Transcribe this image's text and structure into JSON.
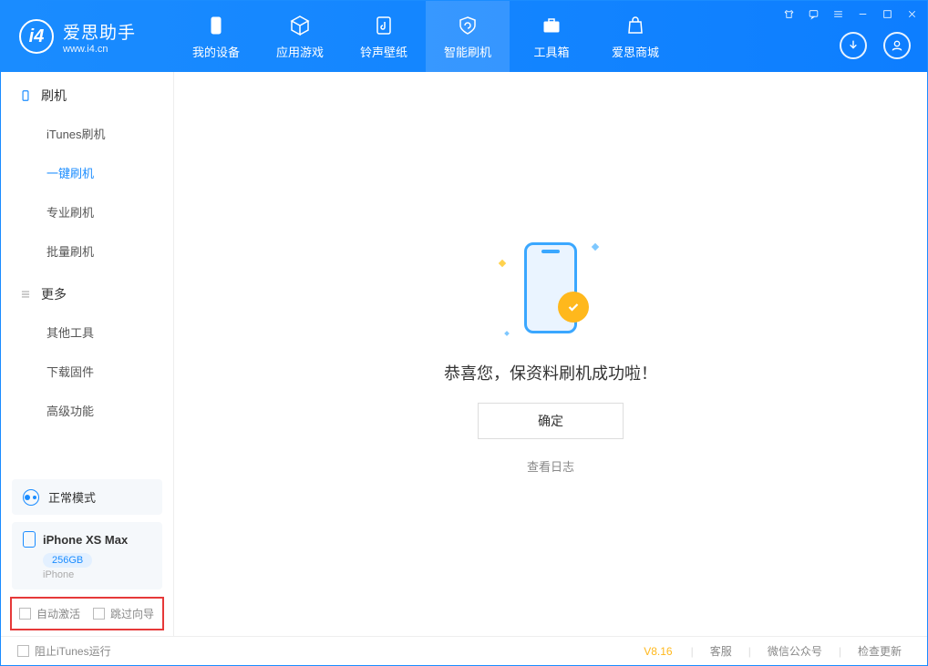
{
  "app": {
    "title": "爱思助手",
    "subtitle": "www.i4.cn"
  },
  "nav": {
    "tabs": [
      {
        "label": "我的设备"
      },
      {
        "label": "应用游戏"
      },
      {
        "label": "铃声壁纸"
      },
      {
        "label": "智能刷机"
      },
      {
        "label": "工具箱"
      },
      {
        "label": "爱思商城"
      }
    ],
    "active_index": 3
  },
  "sidebar": {
    "sections": [
      {
        "title": "刷机",
        "items": [
          {
            "label": "iTunes刷机"
          },
          {
            "label": "一键刷机"
          },
          {
            "label": "专业刷机"
          },
          {
            "label": "批量刷机"
          }
        ],
        "active_index": 1
      },
      {
        "title": "更多",
        "items": [
          {
            "label": "其他工具"
          },
          {
            "label": "下载固件"
          },
          {
            "label": "高级功能"
          }
        ]
      }
    ],
    "mode": {
      "label": "正常模式"
    },
    "device": {
      "name": "iPhone XS Max",
      "storage": "256GB",
      "type": "iPhone"
    },
    "checkboxes": {
      "auto_activate": "自动激活",
      "skip_guide": "跳过向导"
    }
  },
  "main": {
    "success_message": "恭喜您，保资料刷机成功啦！",
    "confirm_button": "确定",
    "view_log": "查看日志"
  },
  "footer": {
    "block_itunes": "阻止iTunes运行",
    "version": "V8.16",
    "links": {
      "support": "客服",
      "wechat": "微信公众号",
      "check_update": "检查更新"
    }
  }
}
